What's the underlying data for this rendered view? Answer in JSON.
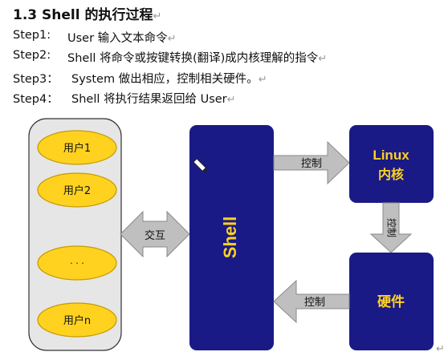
{
  "document": {
    "heading": "1.3 Shell 的执行过程",
    "paragraph_mark": "↵",
    "steps": [
      {
        "label": "Step1:",
        "text": "User  输入文本命令"
      },
      {
        "label": "Step2:",
        "text": "Shell 将命令或按键转换(翻译)成内核理解的指令"
      },
      {
        "label": "Step3：",
        "text": "System 做出相应，控制相关硬件。"
      },
      {
        "label": "Step4：",
        "text": "Shell 将执行结果返回给 User"
      }
    ]
  },
  "diagram": {
    "users": [
      "用户1",
      "用户2",
      "· · ·",
      "用户n"
    ],
    "interact_label": "交互",
    "shell_label": "Shell",
    "kernel_label_line1": "Linux",
    "kernel_label_line2": "内核",
    "hardware_label": "硬件",
    "arrow_shell_kernel_label": "控制",
    "arrow_kernel_hardware_label": "控制",
    "arrow_hardware_shell_label": "控制",
    "colors": {
      "user_ellipse_fill": "#ffd21f",
      "user_ellipse_stroke": "#c79a00",
      "users_panel_fill": "#e6e6e6",
      "box_fill": "#1a1a86",
      "shell_text": "#ffd21f",
      "kernel_text": "#ffd21f",
      "hardware_text": "#ffd21f",
      "arrow_fill": "#bfbfbf",
      "arrow_stroke": "#8a8a8a"
    }
  }
}
